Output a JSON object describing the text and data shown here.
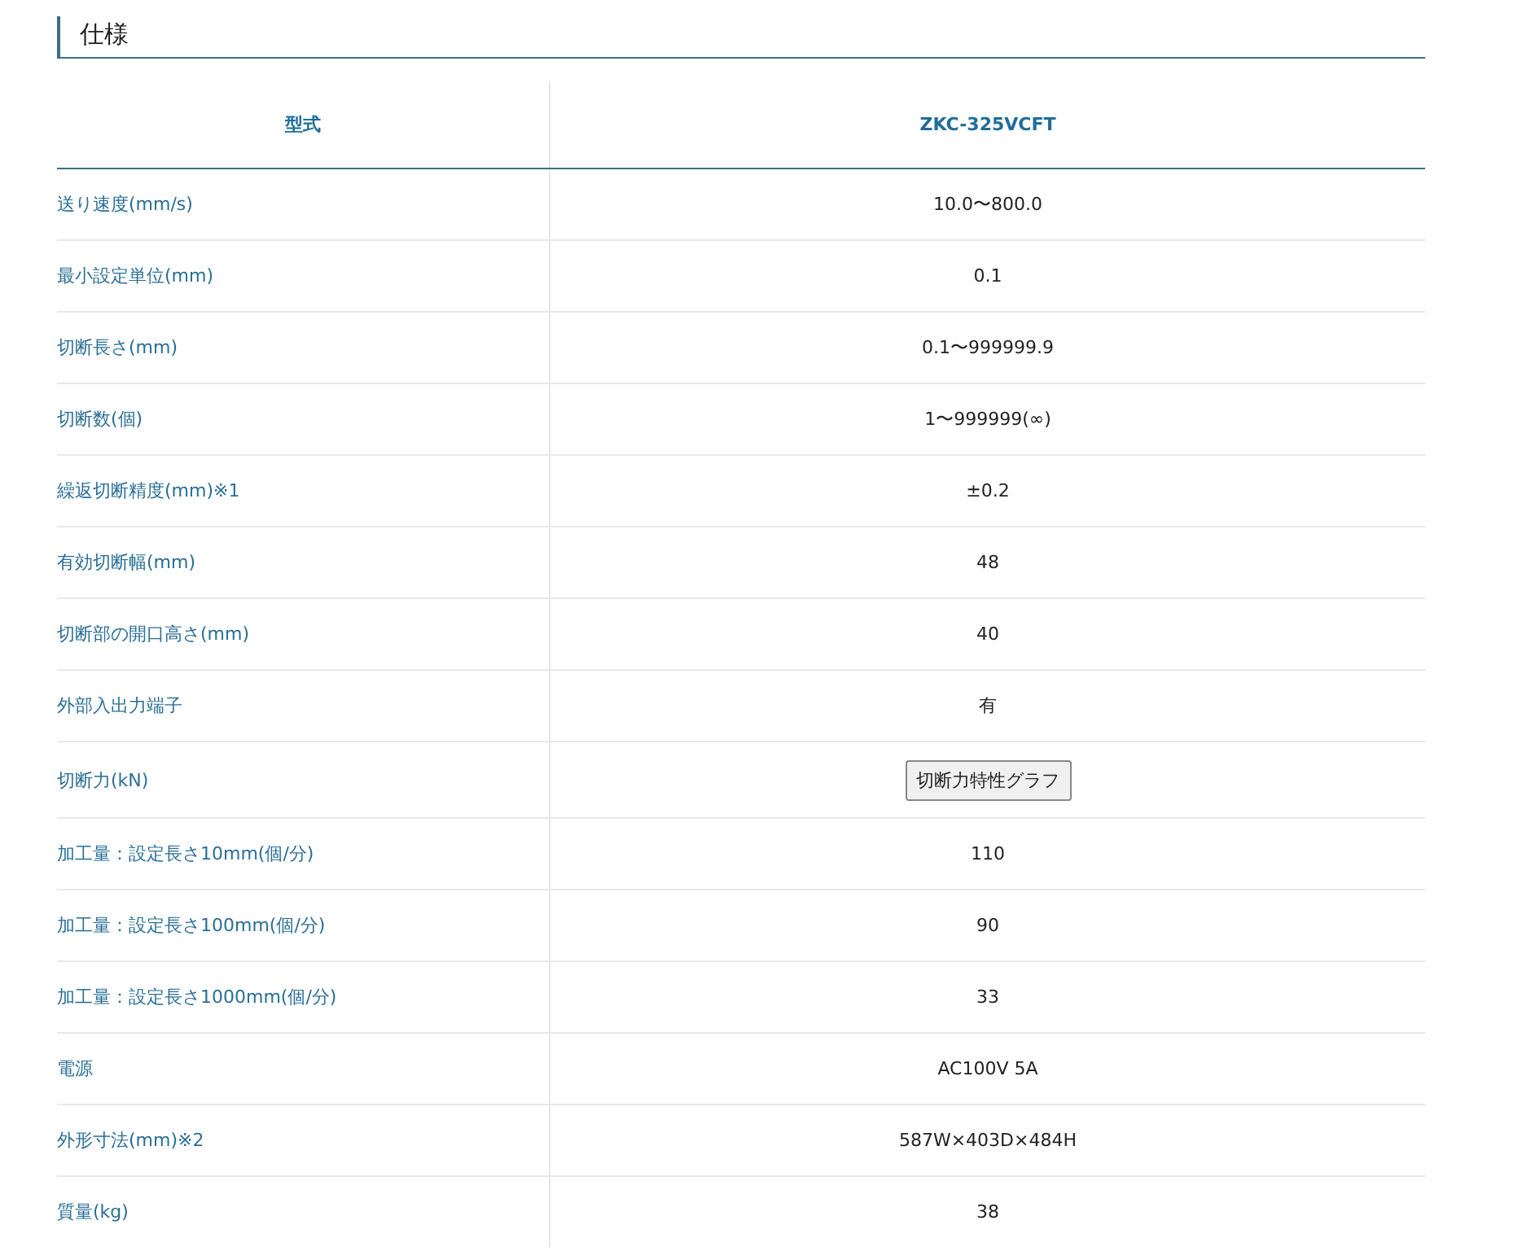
{
  "section_title": "仕様",
  "table": {
    "header": {
      "label": "型式",
      "model": "ZKC-325VCFT"
    },
    "rows": [
      {
        "label": "送り速度(mm/s)",
        "kind": "text",
        "value": "10.0〜800.0"
      },
      {
        "label": "最小設定単位(mm)",
        "kind": "text",
        "value": "0.1"
      },
      {
        "label": "切断長さ(mm)",
        "kind": "text",
        "value": "0.1〜999999.9"
      },
      {
        "label": "切断数(個)",
        "kind": "text",
        "value": "1〜999999(∞)"
      },
      {
        "label": "繰返切断精度(mm)※1",
        "kind": "text",
        "value": "±0.2"
      },
      {
        "label": "有効切断幅(mm)",
        "kind": "text",
        "value": "48"
      },
      {
        "label": "切断部の開口高さ(mm)",
        "kind": "text",
        "value": "40"
      },
      {
        "label": "外部入出力端子",
        "kind": "text",
        "value": "有"
      },
      {
        "label": "切断力(kN)",
        "kind": "button",
        "value": "切断力特性グラフ"
      },
      {
        "label": "加工量：設定長さ10mm(個/分)",
        "kind": "text",
        "value": "110"
      },
      {
        "label": "加工量：設定長さ100mm(個/分)",
        "kind": "text",
        "value": "90"
      },
      {
        "label": "加工量：設定長さ1000mm(個/分)",
        "kind": "text",
        "value": "33"
      },
      {
        "label": "電源",
        "kind": "text",
        "value": "AC100V 5A"
      },
      {
        "label": "外形寸法(mm)※2",
        "kind": "text",
        "value": "587W×403D×484H"
      },
      {
        "label": "質量(kg)",
        "kind": "text",
        "value": "38"
      }
    ]
  }
}
